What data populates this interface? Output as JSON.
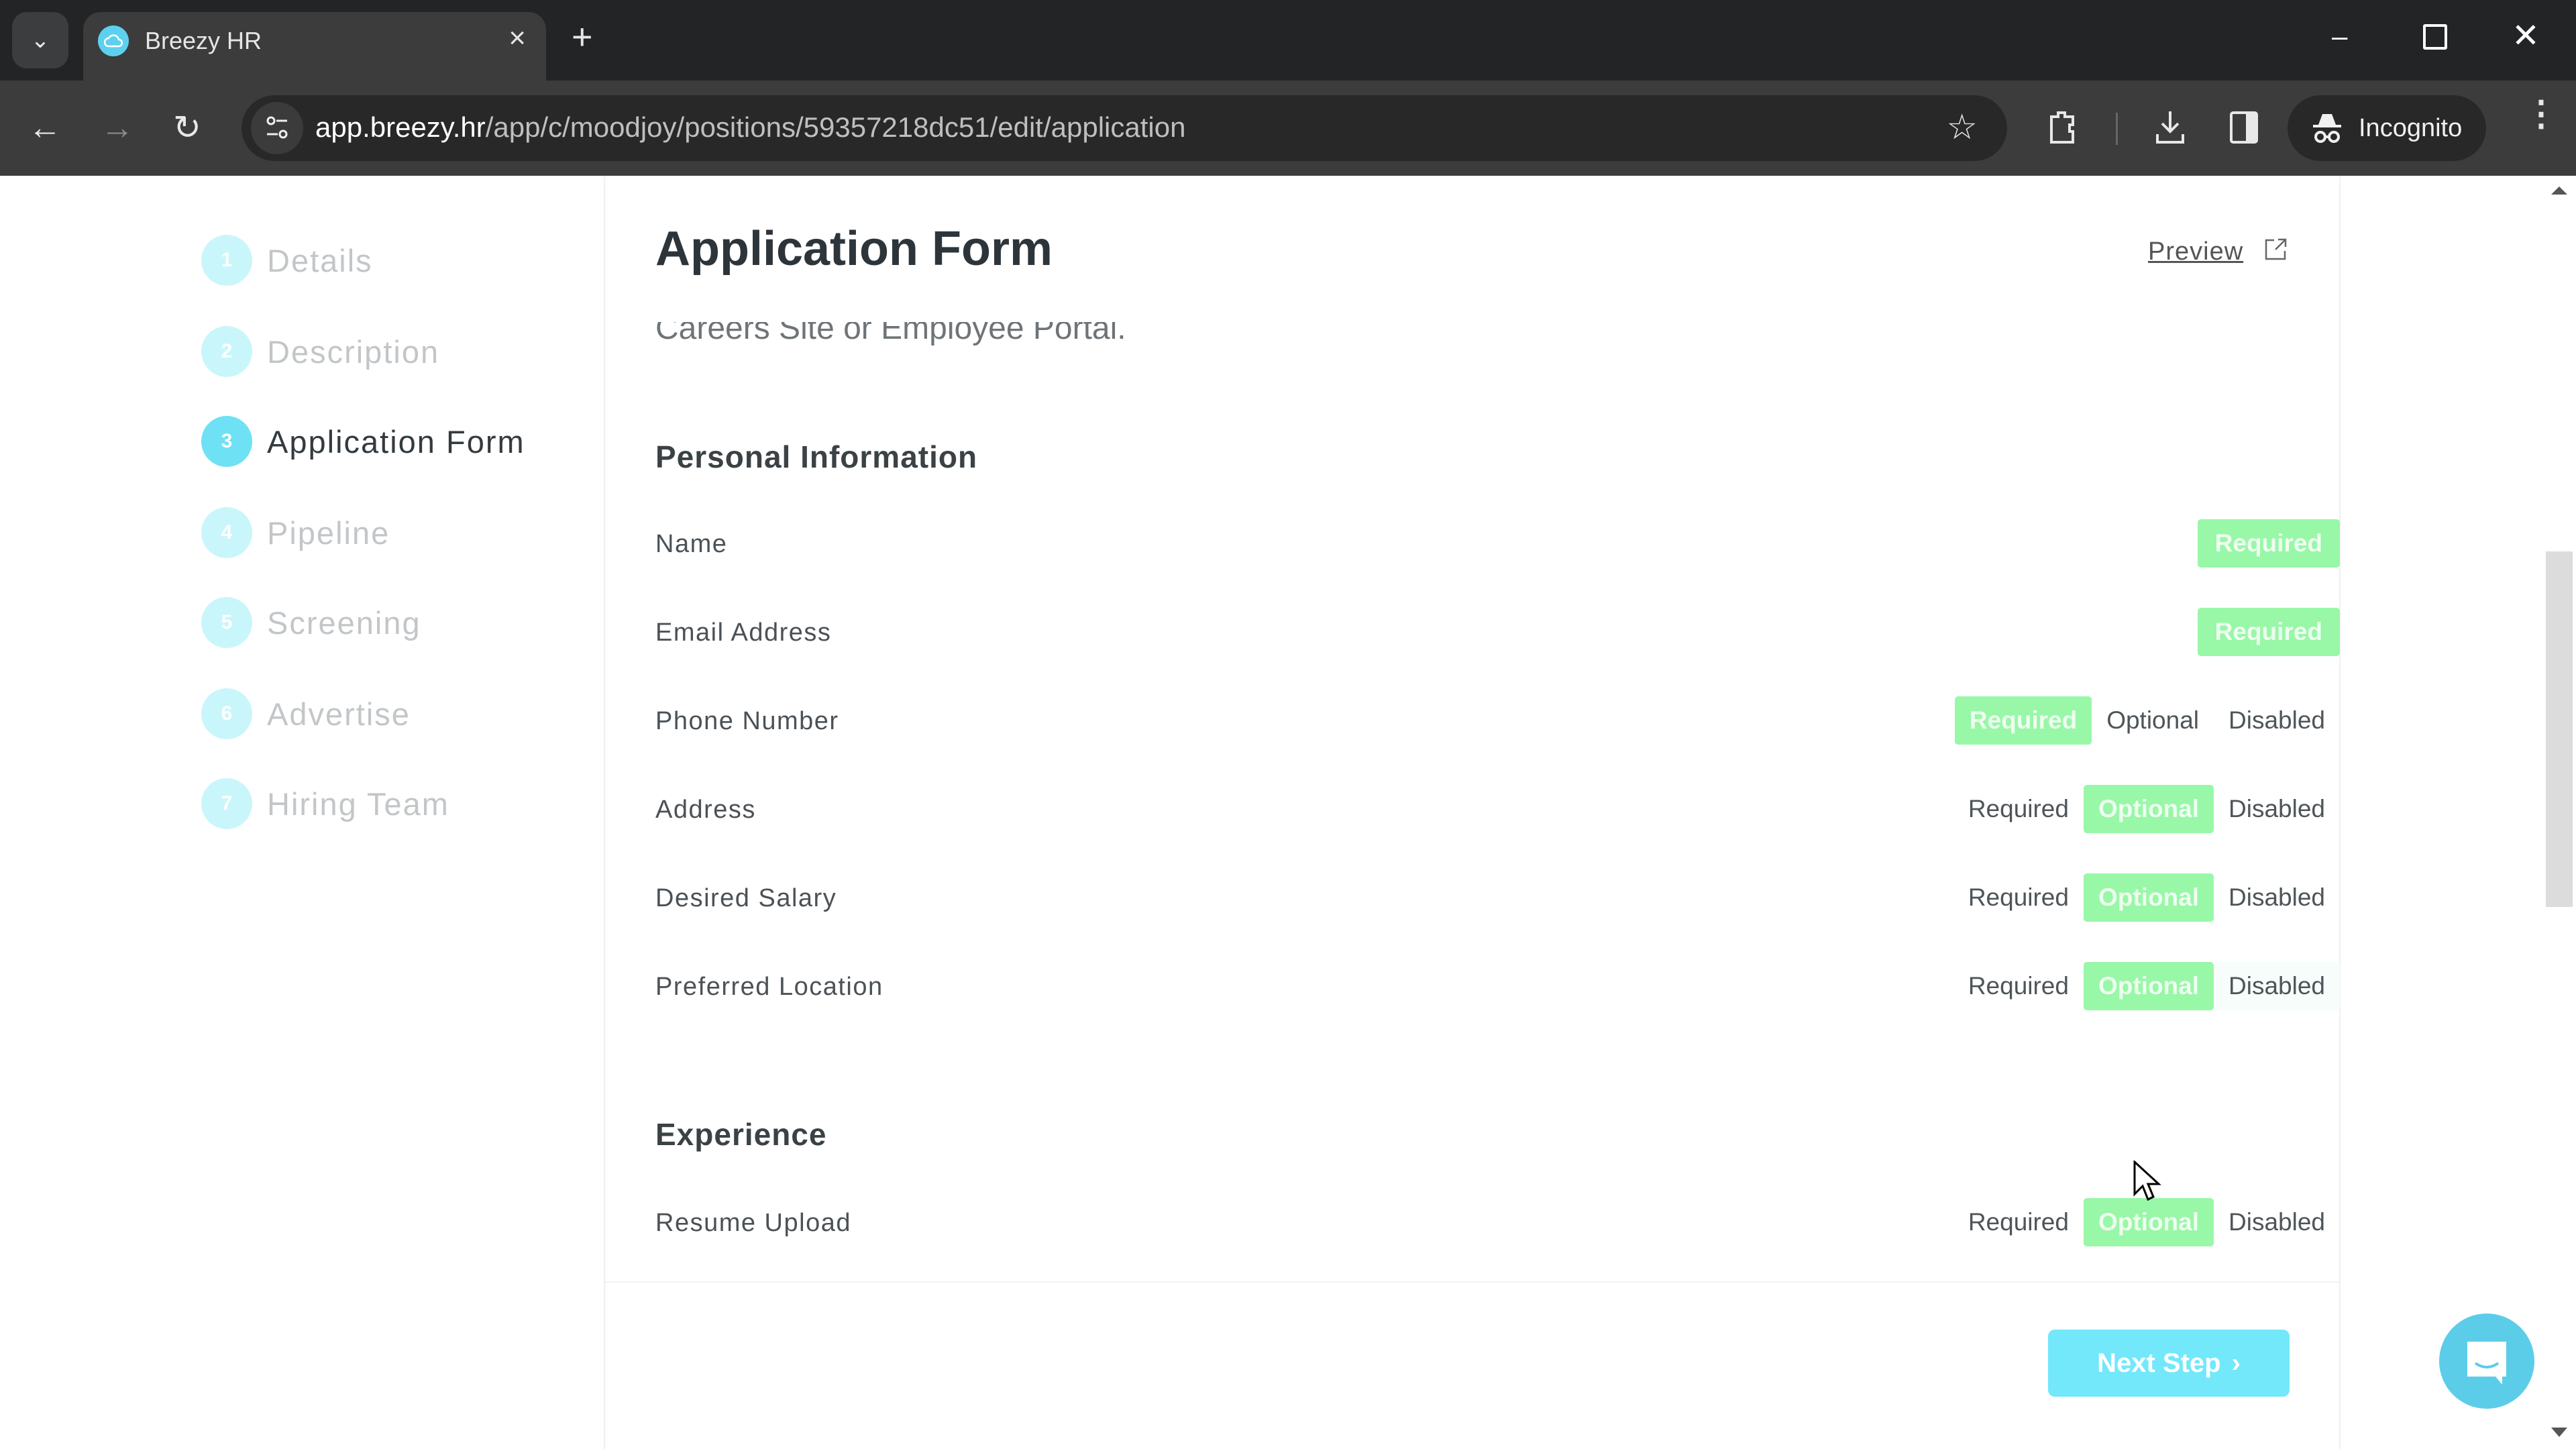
{
  "browser": {
    "tab_title": "Breezy HR",
    "tab_close": "×",
    "new_tab": "+",
    "url_domain": "app.breezy.hr",
    "url_path": "/app/c/moodjoy/positions/59357218dc51/edit/application",
    "incognito_label": "Incognito",
    "icons": {
      "tab_dropdown": "chevron-down-icon",
      "favicon": "breezy-cloud-icon",
      "back": "←",
      "forward": "→",
      "reload": "↻",
      "bookmark": "☆",
      "minimize": "–",
      "close": "✕"
    }
  },
  "sidebar": {
    "steps": [
      {
        "num": "1",
        "label": "Details",
        "active": false
      },
      {
        "num": "2",
        "label": "Description",
        "active": false
      },
      {
        "num": "3",
        "label": "Application Form",
        "active": true
      },
      {
        "num": "4",
        "label": "Pipeline",
        "active": false
      },
      {
        "num": "5",
        "label": "Screening",
        "active": false
      },
      {
        "num": "6",
        "label": "Advertise",
        "active": false
      },
      {
        "num": "7",
        "label": "Hiring Team",
        "active": false
      }
    ]
  },
  "main": {
    "title": "Application Form",
    "preview_label": "Preview",
    "intro_text": "Careers Site or Employee Portal.",
    "sections": [
      {
        "title": "Personal Information",
        "fields": [
          {
            "label": "Name",
            "options": [
              "Required"
            ],
            "selected": "Required"
          },
          {
            "label": "Email Address",
            "options": [
              "Required"
            ],
            "selected": "Required"
          },
          {
            "label": "Phone Number",
            "options": [
              "Required",
              "Optional",
              "Disabled"
            ],
            "selected": "Required"
          },
          {
            "label": "Address",
            "options": [
              "Required",
              "Optional",
              "Disabled"
            ],
            "selected": "Optional"
          },
          {
            "label": "Desired Salary",
            "options": [
              "Required",
              "Optional",
              "Disabled"
            ],
            "selected": "Optional"
          },
          {
            "label": "Preferred Location",
            "options": [
              "Required",
              "Optional",
              "Disabled"
            ],
            "selected": "Optional"
          }
        ]
      },
      {
        "title": "Experience",
        "fields": [
          {
            "label": "Resume Upload",
            "options": [
              "Required",
              "Optional",
              "Disabled"
            ],
            "selected": "Optional"
          }
        ]
      }
    ],
    "next_step_label": "Next Step",
    "next_step_chevron": "›"
  },
  "colors": {
    "selected_option": "#99f7a8",
    "step_active": "#6ee1f5",
    "step_inactive": "#c9f6fb",
    "next_button": "#72e8fa",
    "chat_button": "#5ccde9"
  }
}
